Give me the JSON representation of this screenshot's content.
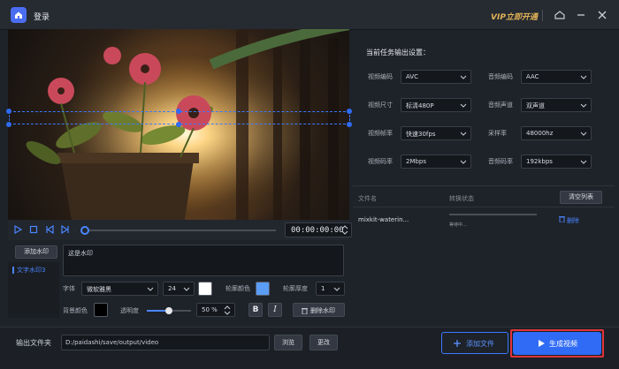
{
  "app": {
    "login_label": "登录",
    "vip_label": "VIP立即开通"
  },
  "player": {
    "time": "00:00:00:00"
  },
  "watermark": {
    "add_button": "添加水印",
    "items": [
      "文字水印3"
    ],
    "text_value": "这是水印",
    "font_label": "字体",
    "font_value": "微软雅黑",
    "size_value": "24",
    "outline_color_label": "轮廓颜色",
    "outline_width_label": "轮廓厚度",
    "outline_width_value": "1",
    "bg_color_label": "背景颜色",
    "opacity_label": "透明度",
    "opacity_value": "50 %",
    "bold_label": "B",
    "italic_label": "I",
    "delete_button": "删除水印",
    "colors": {
      "text": "#ffffff",
      "outline": "#5b9cf5",
      "background": "#000000"
    }
  },
  "settings": {
    "title": "当前任务输出设置：",
    "fields": [
      {
        "label": "视频编码",
        "value": "AVC"
      },
      {
        "label": "音频编码",
        "value": "AAC"
      },
      {
        "label": "视频尺寸",
        "value": "标清480P"
      },
      {
        "label": "音频声道",
        "value": "双声道"
      },
      {
        "label": "视频帧率",
        "value": "快速30fps"
      },
      {
        "label": "采样率",
        "value": "48000hz"
      },
      {
        "label": "视频码率",
        "value": "2Mbps"
      },
      {
        "label": "音频码率",
        "value": "192kbps"
      }
    ]
  },
  "file_list": {
    "col_name": "文件名",
    "col_status": "转换状态",
    "clear_button": "清空列表",
    "rows": [
      {
        "name": "mixkit-waterin...",
        "status": "等待中...",
        "delete": "删除"
      }
    ]
  },
  "output": {
    "label": "输出文件夹",
    "path": "D:/paidashi/save/output/video",
    "browse_button": "浏览",
    "change_button": "更改",
    "add_file_button": "添加文件",
    "generate_button": "生成视频"
  },
  "colors": {
    "accent": "#2f6bf5",
    "vip": "#e2b356",
    "highlight_border": "#e0343b"
  }
}
